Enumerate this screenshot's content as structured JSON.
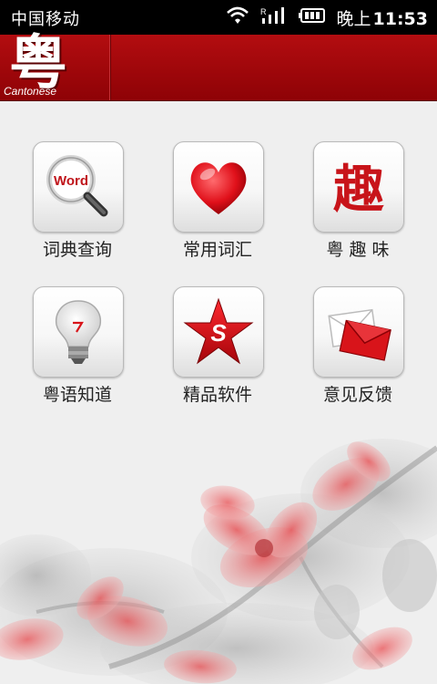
{
  "status_bar": {
    "carrier": "中国移动",
    "time_prefix": "晚上",
    "time": "11:53"
  },
  "header": {
    "logo_char": "粤",
    "logo_subtitle": "Cantonese"
  },
  "menu": [
    {
      "label": "词典查询",
      "icon": "dictionary-search-icon",
      "icon_text": "Word"
    },
    {
      "label": "常用词汇",
      "icon": "heart-icon"
    },
    {
      "label": "粤 趣 味",
      "icon": "fun-character-icon",
      "icon_text": "趣"
    },
    {
      "label": "粤语知道",
      "icon": "lightbulb-icon"
    },
    {
      "label": "精品软件",
      "icon": "star-software-icon",
      "icon_text": "S"
    },
    {
      "label": "意见反馈",
      "icon": "envelope-feedback-icon"
    }
  ],
  "colors": {
    "header_red": "#b30d10",
    "accent_red": "#d8141a"
  }
}
